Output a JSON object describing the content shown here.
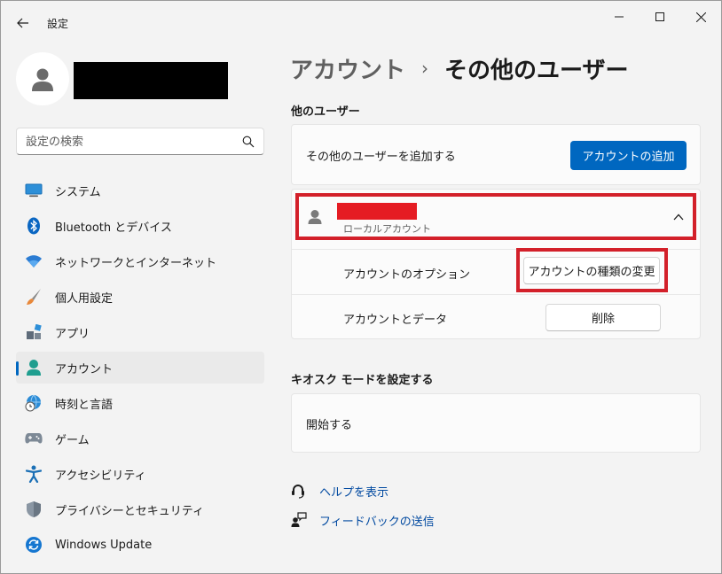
{
  "app": {
    "title": "設定"
  },
  "search": {
    "placeholder": "設定の検索"
  },
  "sidebar": {
    "items": [
      {
        "label": "システム",
        "icon": "monitor-icon"
      },
      {
        "label": "Bluetooth とデバイス",
        "icon": "bluetooth-icon"
      },
      {
        "label": "ネットワークとインターネット",
        "icon": "wifi-icon"
      },
      {
        "label": "個人用設定",
        "icon": "paintbrush-icon"
      },
      {
        "label": "アプリ",
        "icon": "apps-icon"
      },
      {
        "label": "アカウント",
        "icon": "person-icon",
        "selected": true
      },
      {
        "label": "時刻と言語",
        "icon": "globe-clock-icon"
      },
      {
        "label": "ゲーム",
        "icon": "gamepad-icon"
      },
      {
        "label": "アクセシビリティ",
        "icon": "accessibility-icon"
      },
      {
        "label": "プライバシーとセキュリティ",
        "icon": "shield-icon"
      },
      {
        "label": "Windows Update",
        "icon": "update-icon"
      }
    ]
  },
  "breadcrumb": {
    "parent": "アカウント",
    "separator": "›",
    "current": "その他のユーザー"
  },
  "other_users": {
    "section_title": "他のユーザー",
    "add_label": "その他のユーザーを追加する",
    "add_button": "アカウントの追加",
    "user": {
      "account_type": "ローカルアカウント",
      "options_label": "アカウントのオプション",
      "change_type_button": "アカウントの種類の変更",
      "data_label": "アカウントとデータ",
      "delete_button": "削除"
    }
  },
  "kiosk": {
    "section_title": "キオスク モードを設定する",
    "start_label": "開始する"
  },
  "links": {
    "help": "ヘルプを表示",
    "feedback": "フィードバックの送信"
  },
  "colors": {
    "accent": "#0067c0",
    "highlight": "#d3202a"
  }
}
